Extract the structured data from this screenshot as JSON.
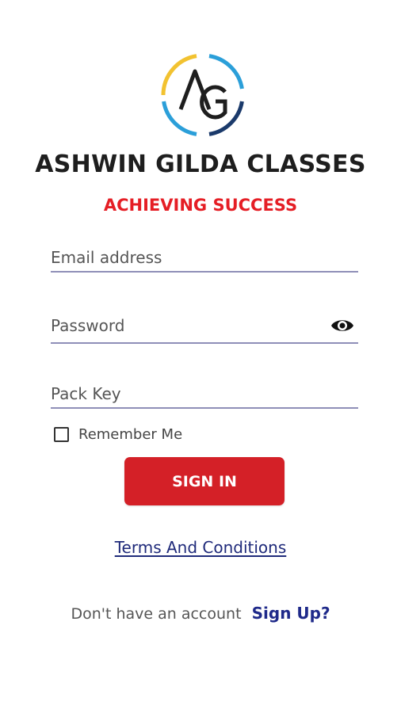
{
  "brand": {
    "logo_text": "AG",
    "name": "ASHWIN GILDA CLASSES",
    "tagline": "ACHIEVING SUCCESS"
  },
  "colors": {
    "accent_red": "#e51e25",
    "button_red": "#d42027",
    "link_blue": "#1f2a8a",
    "logo_yellow": "#f2c230",
    "logo_blue": "#2b9fd9",
    "logo_navy": "#1b3a6b"
  },
  "form": {
    "email": {
      "value": "",
      "placeholder": "Email address"
    },
    "password": {
      "value": "",
      "placeholder": "Password",
      "toggle_icon": "eye-icon"
    },
    "pack_key": {
      "value": "",
      "placeholder": "Pack Key"
    },
    "remember_label": "Remember Me",
    "remember_checked": false,
    "signin_label": "SIGN IN"
  },
  "footer": {
    "terms_label": "Terms And Conditions",
    "signup_prompt": "Don't have an account",
    "signup_label": "Sign Up?"
  }
}
